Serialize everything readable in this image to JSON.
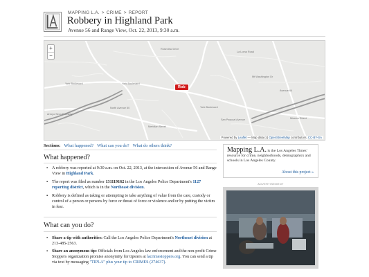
{
  "breadcrumb": {
    "site": "MAPPING L.A.",
    "sep1": ">",
    "section": "CRIME",
    "sep2": ">",
    "page": "REPORT"
  },
  "header": {
    "title": "Robbery in Highland Park",
    "subtitle": "Avenue 56 and Range View, Oct. 22, 2013, 9:30 a.m."
  },
  "map": {
    "zoom_in": "+",
    "zoom_out": "−",
    "marker_label": "Rob",
    "attribution_prefix": "Powered by",
    "attribution_leaflet": "Leaflet",
    "attribution_mid": " — Map data ",
    "attribution_copy": "(c)",
    "attribution_osm": "OpenStreetMap",
    "attribution_contrib": " contributors, ",
    "attribution_license": "CC-BY-SA",
    "streets": {
      "yorkBlvd": "York Boulevard",
      "yorkBlvd2": "York Boulevard",
      "yorkBlvd3": "York Boulevard",
      "arroyoFwy": "Arroyo Seco Freeway",
      "northAve": "North Avenue 50",
      "roseview": "Roseview Drive",
      "lomaRd": "La Loma Road",
      "mtWash": "Mt Washington Dr",
      "mission": "Mission Street",
      "sanPascual": "San Pascual Avenue",
      "meridian": "Meridian Street",
      "ave64": "Avenue 64"
    }
  },
  "sections": {
    "label": "Sections:",
    "links": [
      "What happened?",
      "What can you do?",
      "What do others think?"
    ]
  },
  "happened": {
    "heading": "What happened?",
    "p1": "A robbery was reported at 9:30 a.m. on Oct. 22, 2013, at the intersection of Avenue 56 and Range View in ",
    "p1_link": "Highland Park",
    "p1_end": ".",
    "p2_a": "The report was filed as number ",
    "p2_num": "131119162",
    "p2_b": " in the Los Angeles Police Department's ",
    "p2_link": "1127 reporting district",
    "p2_c": ", which is in the ",
    "p2_link2": "Northeast division",
    "p2_end": ".",
    "p3": "Robbery is defined as taking or attempting to take anything of value from the care, custody or control of a person or persons by force or threat of force or violence and/or by putting the victim in fear."
  },
  "todo": {
    "heading": "What can you do?",
    "b1_strong": "Share a tip with authorities:",
    "b1_text": " Call the Los Angeles Police Department's ",
    "b1_link": "Northeast division",
    "b1_end": " at 213-485-2563.",
    "b2_strong": "Share an anonymous tip:",
    "b2_text": " Officials from Los Angeles law enforcement and the non-profit Crime Stoppers organization promise anonymity for tipsters at ",
    "b2_link": "lacrimestoppers.org",
    "b2_mid": ". You can send a tip via text by messaging ",
    "b2_link2": "\"TIPLA\" plus your tip to CRIMES (274637)",
    "b2_end": "."
  },
  "sidebar": {
    "brand": "Mapping L.A.",
    "desc": " is the Los Angeles Times' resource for crime, neighborhoods, demographics and schools in Los Angeles County.",
    "more": "About this project »",
    "ad_label": "advertisement"
  },
  "colors": {
    "link": "#1a5a9c",
    "marker": "#d01b1b",
    "map_bg": "#eaeaea"
  }
}
